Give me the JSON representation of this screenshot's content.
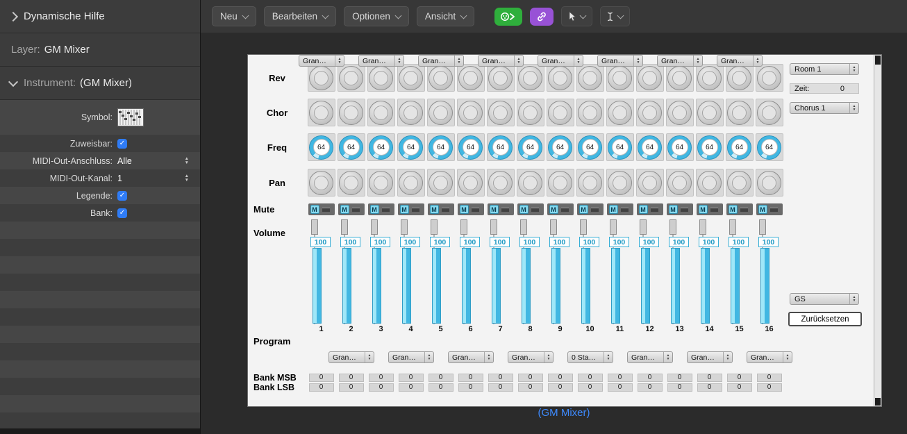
{
  "colors": {
    "accent_blue": "#3e8bff",
    "fader_cyan": "#41b7e2",
    "mute_cyan": "#85d9ef",
    "toolbar_green": "#2faf3c",
    "toolbar_purple": "#9852d6",
    "checkbox_blue": "#2f7cf6"
  },
  "sidebar": {
    "help": {
      "title": "Dynamische Hilfe"
    },
    "layer": {
      "label": "Layer:",
      "value": "GM Mixer"
    },
    "instrument": {
      "label": "Instrument:",
      "value": "(GM Mixer)"
    },
    "rows": [
      {
        "name": "symbol",
        "label": "Symbol:",
        "type": "icon",
        "icon": "mixer-symbol-icon"
      },
      {
        "name": "zuweisbar",
        "label": "Zuweisbar:",
        "type": "checkbox",
        "checked": true
      },
      {
        "name": "midi-out-anschluss",
        "label": "MIDI-Out-Anschluss:",
        "type": "stepper",
        "value": "Alle"
      },
      {
        "name": "midi-out-kanal",
        "label": "MIDI-Out-Kanal:",
        "type": "stepper",
        "value": "1"
      },
      {
        "name": "legende",
        "label": "Legende:",
        "type": "checkbox",
        "checked": true
      },
      {
        "name": "bank",
        "label": "Bank:",
        "type": "checkbox",
        "checked": true
      }
    ],
    "empty_row_count": 12
  },
  "toolbar": {
    "menus": [
      {
        "id": "neu",
        "label": "Neu"
      },
      {
        "id": "bearbeiten",
        "label": "Bearbeiten"
      },
      {
        "id": "optionen",
        "label": "Optionen"
      },
      {
        "id": "ansicht",
        "label": "Ansicht"
      }
    ]
  },
  "mixer": {
    "rows": {
      "rev": "Rev",
      "chor": "Chor",
      "freq": "Freq",
      "pan": "Pan",
      "mute": "Mute",
      "volume": "Volume",
      "program": "Program",
      "bank_msb": "Bank MSB",
      "bank_lsb": "Bank LSB"
    },
    "mute_glyph": "M",
    "channels": [
      {
        "number": 1,
        "freq": 64,
        "volume": 100,
        "program": "Gran…",
        "bank_msb": 0,
        "bank_lsb": 0
      },
      {
        "number": 2,
        "freq": 64,
        "volume": 100,
        "program": "Gran…",
        "bank_msb": 0,
        "bank_lsb": 0
      },
      {
        "number": 3,
        "freq": 64,
        "volume": 100,
        "program": "Gran…",
        "bank_msb": 0,
        "bank_lsb": 0
      },
      {
        "number": 4,
        "freq": 64,
        "volume": 100,
        "program": "Gran…",
        "bank_msb": 0,
        "bank_lsb": 0
      },
      {
        "number": 5,
        "freq": 64,
        "volume": 100,
        "program": "Gran…",
        "bank_msb": 0,
        "bank_lsb": 0
      },
      {
        "number": 6,
        "freq": 64,
        "volume": 100,
        "program": "Gran…",
        "bank_msb": 0,
        "bank_lsb": 0
      },
      {
        "number": 7,
        "freq": 64,
        "volume": 100,
        "program": "Gran…",
        "bank_msb": 0,
        "bank_lsb": 0
      },
      {
        "number": 8,
        "freq": 64,
        "volume": 100,
        "program": "Gran…",
        "bank_msb": 0,
        "bank_lsb": 0
      },
      {
        "number": 9,
        "freq": 64,
        "volume": 100,
        "program": "Gran…",
        "bank_msb": 0,
        "bank_lsb": 0
      },
      {
        "number": 10,
        "freq": 64,
        "volume": 100,
        "program": "0 Sta…",
        "bank_msb": 0,
        "bank_lsb": 0
      },
      {
        "number": 11,
        "freq": 64,
        "volume": 100,
        "program": "Gran…",
        "bank_msb": 0,
        "bank_lsb": 0
      },
      {
        "number": 12,
        "freq": 64,
        "volume": 100,
        "program": "Gran…",
        "bank_msb": 0,
        "bank_lsb": 0
      },
      {
        "number": 13,
        "freq": 64,
        "volume": 100,
        "program": "Gran…",
        "bank_msb": 0,
        "bank_lsb": 0
      },
      {
        "number": 14,
        "freq": 64,
        "volume": 100,
        "program": "Gran…",
        "bank_msb": 0,
        "bank_lsb": 0
      },
      {
        "number": 15,
        "freq": 64,
        "volume": 100,
        "program": "Gran…",
        "bank_msb": 0,
        "bank_lsb": 0
      },
      {
        "number": 16,
        "freq": 64,
        "volume": 100,
        "program": "Gran…",
        "bank_msb": 0,
        "bank_lsb": 0
      }
    ],
    "side": {
      "reverb_type": "Room 1",
      "zeit_label": "Zeit:",
      "zeit_value": "0",
      "chorus_type": "Chorus 1",
      "bank_mode": "GS",
      "reset_label": "Zurücksetzen"
    },
    "caption": "(GM Mixer)"
  }
}
